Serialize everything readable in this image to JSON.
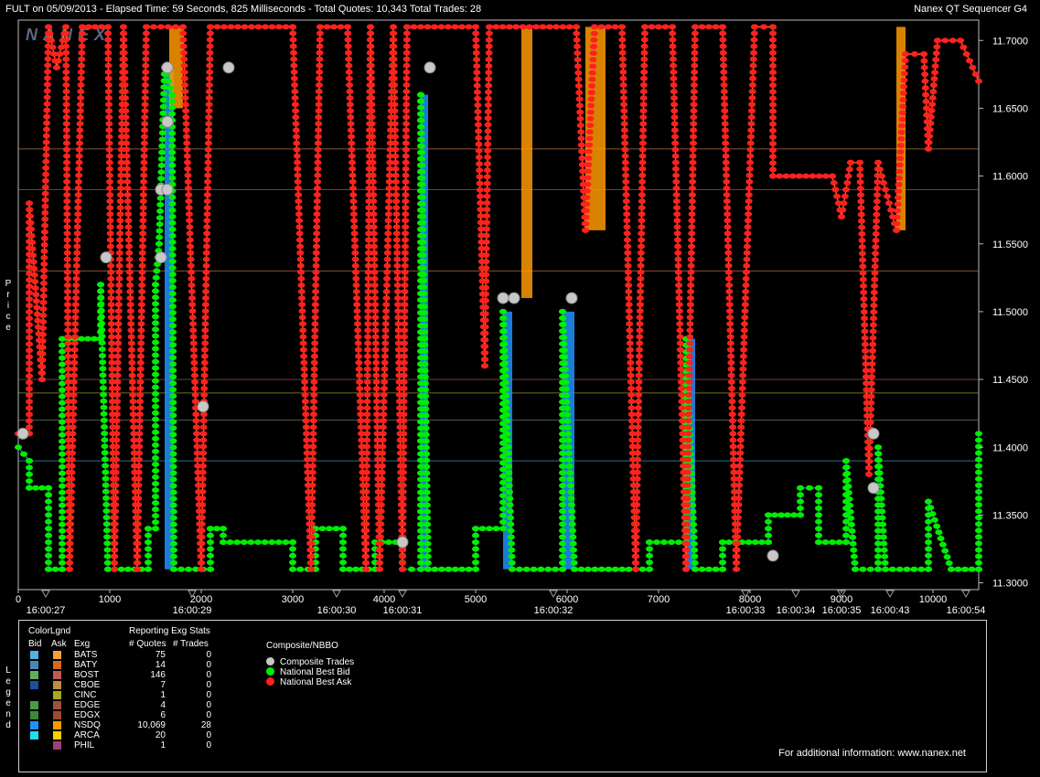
{
  "header": {
    "left": "FULT on 05/09/2013  -  Elapsed Time: 59 Seconds, 825 Milliseconds  -  Total Quotes: 10,343  Total Trades: 28",
    "right": "Nanex QT Sequencer G4"
  },
  "watermark": "NANEX",
  "y_axis_title": "Price",
  "legend_title": "Legend",
  "chart_data": {
    "type": "scatter",
    "xlim": [
      0,
      10500
    ],
    "ylim": [
      11.295,
      11.715
    ],
    "y_ticks": [
      "11.3000",
      "11.3500",
      "11.4000",
      "11.4500",
      "11.5000",
      "11.5500",
      "11.6000",
      "11.6500",
      "11.7000"
    ],
    "x_ticks": [
      "0",
      "1000",
      "2000",
      "3000",
      "4000",
      "5000",
      "6000",
      "7000",
      "8000",
      "9000",
      "10000"
    ],
    "time_labels": [
      {
        "x": 300,
        "label": "16:00:27"
      },
      {
        "x": 1900,
        "label": "16:00:29"
      },
      {
        "x": 3480,
        "label": "16:00:30"
      },
      {
        "x": 4200,
        "label": "16:00:31"
      },
      {
        "x": 5850,
        "label": "16:00:32"
      },
      {
        "x": 7950,
        "label": "16:00:33"
      },
      {
        "x": 8500,
        "label": "16:00:34"
      },
      {
        "x": 9000,
        "label": "16:00:35"
      },
      {
        "x": 9530,
        "label": "16:00:43"
      },
      {
        "x": 10360,
        "label": "16:00:54"
      }
    ],
    "series": [
      {
        "name": "Composite Trades",
        "color": "#c8c8c8",
        "points": [
          [
            50,
            11.41
          ],
          [
            960,
            11.54
          ],
          [
            1560,
            11.54
          ],
          [
            1560,
            11.59
          ],
          [
            1630,
            11.59
          ],
          [
            1630,
            11.64
          ],
          [
            1630,
            11.68
          ],
          [
            2020,
            11.43
          ],
          [
            2300,
            11.68
          ],
          [
            4200,
            11.33
          ],
          [
            4500,
            11.68
          ],
          [
            5300,
            11.51
          ],
          [
            5420,
            11.51
          ],
          [
            6050,
            11.51
          ],
          [
            8250,
            11.32
          ],
          [
            9350,
            11.37
          ],
          [
            9350,
            11.41
          ]
        ]
      },
      {
        "name": "National Best Bid",
        "color": "#00ee00",
        "segments": [
          [
            0,
            11.4
          ],
          [
            120,
            11.39
          ],
          [
            120,
            11.37
          ],
          [
            330,
            11.37
          ],
          [
            330,
            11.31
          ],
          [
            480,
            11.31
          ],
          [
            480,
            11.48
          ],
          [
            900,
            11.48
          ],
          [
            900,
            11.52
          ],
          [
            980,
            11.31
          ],
          [
            1420,
            11.31
          ],
          [
            1420,
            11.34
          ],
          [
            1500,
            11.34
          ],
          [
            1500,
            11.52
          ],
          [
            1540,
            11.55
          ],
          [
            1600,
            11.68
          ],
          [
            1680,
            11.66
          ],
          [
            1700,
            11.31
          ],
          [
            2100,
            11.31
          ],
          [
            2100,
            11.34
          ],
          [
            2240,
            11.34
          ],
          [
            2240,
            11.33
          ],
          [
            3000,
            11.33
          ],
          [
            3000,
            11.31
          ],
          [
            3250,
            11.31
          ],
          [
            3250,
            11.34
          ],
          [
            3550,
            11.34
          ],
          [
            3550,
            11.31
          ],
          [
            3900,
            11.31
          ],
          [
            3900,
            11.33
          ],
          [
            4200,
            11.33
          ],
          [
            4200,
            11.31
          ],
          [
            4400,
            11.31
          ],
          [
            4400,
            11.66
          ],
          [
            4480,
            11.31
          ],
          [
            5000,
            11.31
          ],
          [
            5000,
            11.34
          ],
          [
            5300,
            11.34
          ],
          [
            5300,
            11.5
          ],
          [
            5400,
            11.31
          ],
          [
            5950,
            11.31
          ],
          [
            5950,
            11.5
          ],
          [
            6080,
            11.31
          ],
          [
            6900,
            11.31
          ],
          [
            6900,
            11.33
          ],
          [
            7300,
            11.33
          ],
          [
            7300,
            11.48
          ],
          [
            7400,
            11.31
          ],
          [
            7700,
            11.31
          ],
          [
            7700,
            11.33
          ],
          [
            8200,
            11.33
          ],
          [
            8200,
            11.35
          ],
          [
            8550,
            11.35
          ],
          [
            8550,
            11.37
          ],
          [
            8750,
            11.37
          ],
          [
            8750,
            11.33
          ],
          [
            9050,
            11.33
          ],
          [
            9050,
            11.39
          ],
          [
            9150,
            11.31
          ],
          [
            9400,
            11.31
          ],
          [
            9400,
            11.4
          ],
          [
            9480,
            11.31
          ],
          [
            9950,
            11.31
          ],
          [
            9950,
            11.36
          ],
          [
            10200,
            11.31
          ],
          [
            10500,
            11.31
          ],
          [
            10500,
            11.41
          ]
        ]
      },
      {
        "name": "National Best Ask",
        "color": "#ff2020",
        "segments": [
          [
            0,
            11.41
          ],
          [
            120,
            11.41
          ],
          [
            120,
            11.58
          ],
          [
            260,
            11.45
          ],
          [
            330,
            11.71
          ],
          [
            420,
            11.68
          ],
          [
            520,
            11.71
          ],
          [
            560,
            11.31
          ],
          [
            700,
            11.71
          ],
          [
            980,
            11.71
          ],
          [
            1050,
            11.31
          ],
          [
            1150,
            11.71
          ],
          [
            1300,
            11.31
          ],
          [
            1400,
            11.71
          ],
          [
            1800,
            11.71
          ],
          [
            2000,
            11.31
          ],
          [
            2100,
            11.71
          ],
          [
            3000,
            11.71
          ],
          [
            3200,
            11.31
          ],
          [
            3300,
            11.71
          ],
          [
            3600,
            11.71
          ],
          [
            3800,
            11.31
          ],
          [
            3850,
            11.71
          ],
          [
            3950,
            11.31
          ],
          [
            4100,
            11.71
          ],
          [
            4200,
            11.31
          ],
          [
            4250,
            11.71
          ],
          [
            5000,
            11.71
          ],
          [
            5100,
            11.46
          ],
          [
            5150,
            11.71
          ],
          [
            6100,
            11.71
          ],
          [
            6200,
            11.56
          ],
          [
            6300,
            11.71
          ],
          [
            6600,
            11.71
          ],
          [
            6750,
            11.31
          ],
          [
            6850,
            11.71
          ],
          [
            7150,
            11.71
          ],
          [
            7300,
            11.31
          ],
          [
            7400,
            11.71
          ],
          [
            7700,
            11.71
          ],
          [
            7850,
            11.31
          ],
          [
            8050,
            11.71
          ],
          [
            8250,
            11.71
          ],
          [
            8250,
            11.6
          ],
          [
            8900,
            11.6
          ],
          [
            9000,
            11.57
          ],
          [
            9100,
            11.61
          ],
          [
            9200,
            11.61
          ],
          [
            9300,
            11.38
          ],
          [
            9400,
            11.61
          ],
          [
            9600,
            11.56
          ],
          [
            9700,
            11.69
          ],
          [
            9900,
            11.69
          ],
          [
            9950,
            11.62
          ],
          [
            10050,
            11.7
          ],
          [
            10300,
            11.7
          ],
          [
            10500,
            11.67
          ]
        ]
      }
    ]
  },
  "legend": {
    "color_legend_title": "ColorLgnd",
    "col_bid": "Bid",
    "col_ask": "Ask",
    "col_exg": "Exg",
    "stats_title": "Reporting Exg Stats",
    "col_quotes": "# Quotes",
    "col_trades": "# Trades",
    "exchanges": [
      {
        "exg": "BATS",
        "quotes": "75",
        "trades": "0",
        "bid": "#4fb3e0",
        "ask": "#f0a040"
      },
      {
        "exg": "BATY",
        "quotes": "14",
        "trades": "0",
        "bid": "#4a86b8",
        "ask": "#d46a20"
      },
      {
        "exg": "BOST",
        "quotes": "146",
        "trades": "0",
        "bid": "#5fae5f",
        "ask": "#c05a50"
      },
      {
        "exg": "CBOE",
        "quotes": "7",
        "trades": "0",
        "bid": "#1f4f9a",
        "ask": "#b89040"
      },
      {
        "exg": "CINC",
        "quotes": "1",
        "trades": "0",
        "bid": "",
        "ask": "#a8a820"
      },
      {
        "exg": "EDGE",
        "quotes": "4",
        "trades": "0",
        "bid": "#4a9a4a",
        "ask": "#a05040"
      },
      {
        "exg": "EDGX",
        "quotes": "6",
        "trades": "0",
        "bid": "#3a8a3a",
        "ask": "#9a4a30"
      },
      {
        "exg": "NSDQ",
        "quotes": "10,069",
        "trades": "28",
        "bid": "#1e90ff",
        "ask": "#ff9900"
      },
      {
        "exg": "ARCA",
        "quotes": "20",
        "trades": "0",
        "bid": "#22ddee",
        "ask": "#ffcc00"
      },
      {
        "exg": "PHIL",
        "quotes": "1",
        "trades": "0",
        "bid": "",
        "ask": "#a04070"
      }
    ],
    "composite_title": "Composite/NBBO",
    "composite_items": [
      {
        "label": "Composite Trades",
        "color": "#c8c8c8"
      },
      {
        "label": "National Best Bid",
        "color": "#00ee00"
      },
      {
        "label": "National Best Ask",
        "color": "#ff2020"
      }
    ],
    "info": "For additional information: www.nanex.net"
  }
}
